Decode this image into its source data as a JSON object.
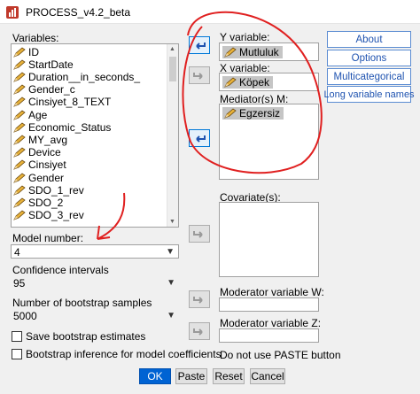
{
  "window": {
    "title": "PROCESS_v4.2_beta",
    "app_icon": "process-app-icon"
  },
  "variables_label": "Variables:",
  "variables": [
    "ID",
    "StartDate",
    "Duration__in_seconds_",
    "Gender_c",
    "Cinsiyet_8_TEXT",
    "Age",
    "Economic_Status",
    "MY_avg",
    "Device",
    "Cinsiyet",
    "Gender",
    "SDO_1_rev",
    "SDO_2",
    "SDO_3_rev"
  ],
  "y_variable": {
    "label": "Y variable:",
    "value": "Mutluluk"
  },
  "x_variable": {
    "label": "X variable:",
    "value": "Köpek"
  },
  "mediators": {
    "label": "Mediator(s) M:",
    "items": [
      "Egzersiz"
    ]
  },
  "covariates": {
    "label": "Covariate(s):"
  },
  "model_number": {
    "label": "Model number:",
    "value": "4"
  },
  "confidence_intervals": {
    "label": "Confidence intervals",
    "value": "95"
  },
  "bootstrap_samples": {
    "label": "Number of bootstrap samples",
    "value": "5000"
  },
  "checkboxes": {
    "save_bootstrap": {
      "label": "Save bootstrap estimates",
      "checked": false
    },
    "bootstrap_inference": {
      "label": "Bootstrap inference for model coefficients",
      "checked": false
    }
  },
  "moderator_w": {
    "label": "Moderator variable W:"
  },
  "moderator_z": {
    "label": "Moderator variable Z:"
  },
  "note": "Do not use PASTE button",
  "side_buttons": {
    "about": "About",
    "options": "Options",
    "multicategorical": "Multicategorical",
    "long_names": "Long variable names"
  },
  "buttons": {
    "ok": "OK",
    "paste": "Paste",
    "reset": "Reset",
    "cancel": "Cancel"
  },
  "colors": {
    "accent": "#0063d3",
    "link_blue": "#1f53b0",
    "annotation_red": "#e02020"
  }
}
